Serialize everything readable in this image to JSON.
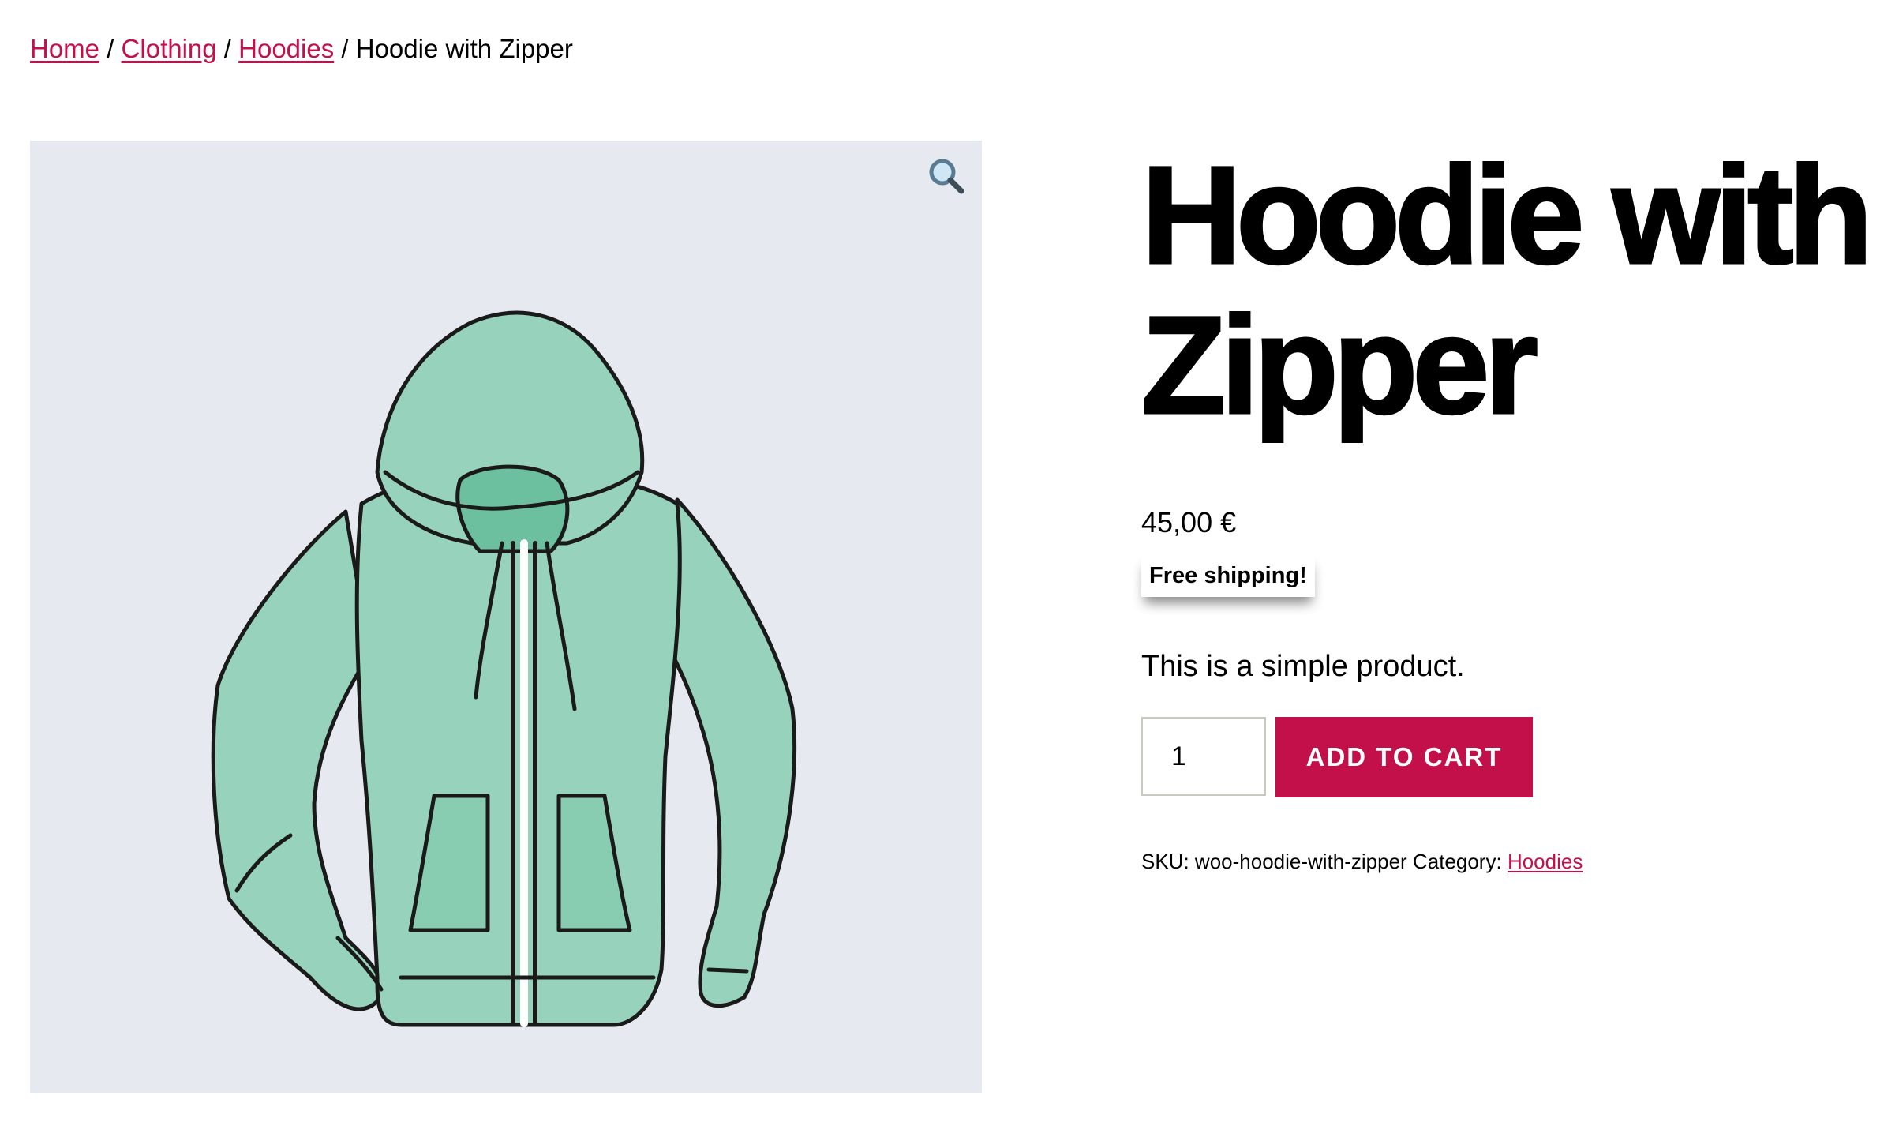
{
  "breadcrumb": {
    "items": [
      "Home",
      "Clothing",
      "Hoodies"
    ],
    "separator": "/",
    "current": "Hoodie with Zipper"
  },
  "gallery": {
    "zoom_icon": "magnifier-icon",
    "image_subject": "hoodie-with-zipper-product-image"
  },
  "product": {
    "title_line1": "Hoodie with",
    "title_line2": "Zipper",
    "price": "45,00 €",
    "shipping_badge": "Free shipping!",
    "short_description": "This is a simple product.",
    "quantity": "1",
    "add_to_cart_label": "ADD TO CART",
    "sku_label": "SKU:",
    "sku_value": "woo-hoodie-with-zipper",
    "category_label": "Category:",
    "category_value": "Hoodies"
  },
  "colors": {
    "accent": "#c30f4a",
    "gallery_bg": "#e6eaf0",
    "hoodie_fill": "#97d3bc",
    "text": "#000000"
  }
}
